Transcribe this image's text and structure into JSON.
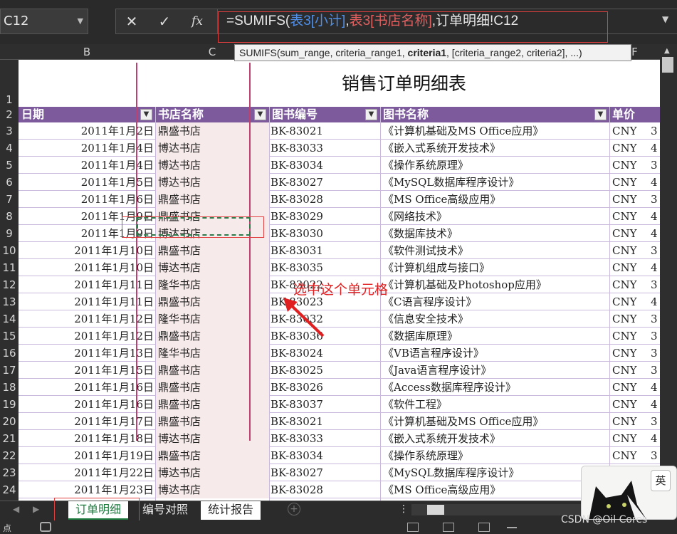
{
  "formula_bar": {
    "name_box": "C12",
    "cancel_icon": "✕",
    "enter_icon": "✓",
    "fx_label": "fx",
    "formula_parts": [
      {
        "text": "=SUMIFS(",
        "color": "default"
      },
      {
        "text": "表3[小计]",
        "color": "blue"
      },
      {
        "text": ",",
        "color": "default"
      },
      {
        "text": "表3[书店名称]",
        "color": "red"
      },
      {
        "text": ",订单明细!C12",
        "color": "default"
      }
    ],
    "tooltip": "SUMIFS(sum_range, criteria_range1, criteria1, [criteria_range2, criteria2], ...)",
    "tooltip_bold": "criteria1"
  },
  "columns": [
    "B",
    "C",
    "D",
    "E",
    "F"
  ],
  "sheet": {
    "title": "销售订单明细表",
    "headers": [
      "日期",
      "书店名称",
      "图书编号",
      "图书名称",
      "单价"
    ],
    "row_numbers": [
      "1",
      "2",
      "3",
      "4",
      "5",
      "6",
      "7",
      "8",
      "9",
      "10",
      "11",
      "12",
      "13",
      "14",
      "15",
      "16",
      "17",
      "18",
      "19",
      "20",
      "21",
      "22",
      "23",
      "24"
    ],
    "rows": [
      [
        "2011年1月2日",
        "鼎盛书店",
        "BK-83021",
        "《计算机基础及MS Office应用》",
        "CNY",
        "3"
      ],
      [
        "2011年1月4日",
        "博达书店",
        "BK-83033",
        "《嵌入式系统开发技术》",
        "CNY",
        "4"
      ],
      [
        "2011年1月4日",
        "博达书店",
        "BK-83034",
        "《操作系统原理》",
        "CNY",
        "3"
      ],
      [
        "2011年1月5日",
        "博达书店",
        "BK-83027",
        "《MySQL数据库程序设计》",
        "CNY",
        "4"
      ],
      [
        "2011年1月6日",
        "鼎盛书店",
        "BK-83028",
        "《MS Office高级应用》",
        "CNY",
        "3"
      ],
      [
        "2011年1月9日",
        "鼎盛书店",
        "BK-83029",
        "《网络技术》",
        "CNY",
        "4"
      ],
      [
        "2011年1月9日",
        "博达书店",
        "BK-83030",
        "《数据库技术》",
        "CNY",
        "4"
      ],
      [
        "2011年1月10日",
        "鼎盛书店",
        "BK-83031",
        "《软件测试技术》",
        "CNY",
        "3"
      ],
      [
        "2011年1月10日",
        "博达书店",
        "BK-83035",
        "《计算机组成与接口》",
        "CNY",
        "4"
      ],
      [
        "2011年1月11日",
        "隆华书店",
        "BK-83022",
        "《计算机基础及Photoshop应用》",
        "CNY",
        "3"
      ],
      [
        "2011年1月11日",
        "鼎盛书店",
        "BK-83023",
        "《C语言程序设计》",
        "CNY",
        "4"
      ],
      [
        "2011年1月12日",
        "隆华书店",
        "BK-83032",
        "《信息安全技术》",
        "CNY",
        "3"
      ],
      [
        "2011年1月12日",
        "鼎盛书店",
        "BK-83036",
        "《数据库原理》",
        "CNY",
        "3"
      ],
      [
        "2011年1月13日",
        "隆华书店",
        "BK-83024",
        "《VB语言程序设计》",
        "CNY",
        "3"
      ],
      [
        "2011年1月15日",
        "鼎盛书店",
        "BK-83025",
        "《Java语言程序设计》",
        "CNY",
        "3"
      ],
      [
        "2011年1月16日",
        "鼎盛书店",
        "BK-83026",
        "《Access数据库程序设计》",
        "CNY",
        "4"
      ],
      [
        "2011年1月16日",
        "鼎盛书店",
        "BK-83037",
        "《软件工程》",
        "CNY",
        "4"
      ],
      [
        "2011年1月17日",
        "鼎盛书店",
        "BK-83021",
        "《计算机基础及MS Office应用》",
        "CNY",
        "3"
      ],
      [
        "2011年1月18日",
        "博达书店",
        "BK-83033",
        "《嵌入式系统开发技术》",
        "CNY",
        "4"
      ],
      [
        "2011年1月19日",
        "鼎盛书店",
        "BK-83034",
        "《操作系统原理》",
        "CNY",
        "3"
      ],
      [
        "2011年1月22日",
        "博达书店",
        "BK-83027",
        "《MySQL数据库程序设计》",
        "CNY",
        "4"
      ],
      [
        "2011年1月23日",
        "博达书店",
        "BK-83028",
        "《MS Office高级应用》",
        "CNY",
        "3"
      ]
    ]
  },
  "annotation": "选中这个单元格",
  "sheet_tabs": [
    "订单明细",
    "编号对照",
    "统计报告"
  ],
  "ime_label": "英",
  "status_left": "点",
  "watermark": "CSDN @Oil Cores",
  "colors": {
    "header_bg": "#7c5a9c",
    "selection": "#2f7a4a",
    "highlight_red": "#e04040"
  }
}
